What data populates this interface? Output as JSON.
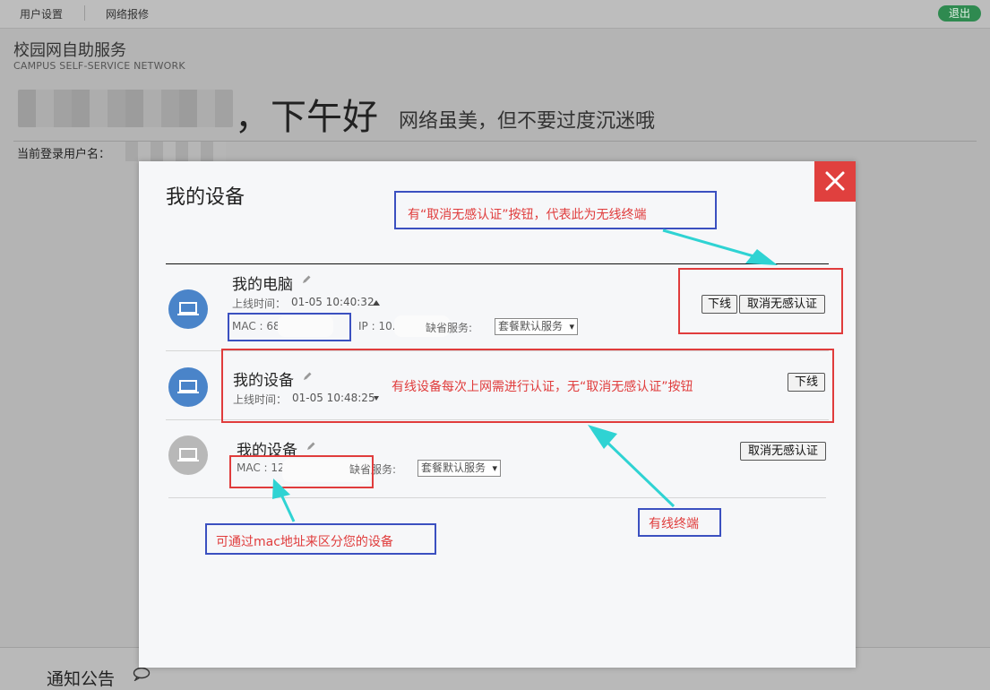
{
  "topnav": {
    "user_settings": "用户设置",
    "network_repair": "网络报修",
    "logout": "退出"
  },
  "brand": {
    "cn": "校园网自助服务",
    "en": "CAMPUS  SELF-SERVICE NETWORK"
  },
  "welcome": {
    "greeting": "，下午好",
    "tagline": "网络虽美，但不要过度沉迷哦",
    "user_label": "当前登录用户名："
  },
  "footer": {
    "notice": "通知公告"
  },
  "modal": {
    "title": "我的设备",
    "devices": [
      {
        "name": "我的电脑",
        "online_time_label": "上线时间：",
        "online_time": "01-05 10:40:32",
        "mac": "MAC : 68",
        "ip": "IP : 10.",
        "service_label": "缺省服务:",
        "service_value": "套餐默认服务",
        "offline_btn": "下线",
        "cancel_btn": "取消无感认证"
      },
      {
        "name": "我的设备",
        "online_time_label": "上线时间：",
        "online_time": "01-05 10:48:25",
        "offline_btn": "下线"
      },
      {
        "name": "我的设备",
        "mac": "MAC : 12",
        "service_label": "缺省服务:",
        "service_value": "套餐默认服务",
        "cancel_btn": "取消无感认证"
      }
    ]
  },
  "annotations": {
    "wireless_note": "有“取消无感认证”按钮，代表此为无线终端",
    "wired_note": "有线设备每次上网需进行认证，无“取消无感认证”按钮",
    "wired_label": "有线终端",
    "mac_note": "可通过mac地址来区分您的设备"
  },
  "colors": {
    "accent_blue": "#4a84c9",
    "close_red": "#e0403e",
    "annotation_red": "#e03c3c",
    "annotation_blue": "#3b50c0",
    "arrow_cyan": "#2fd3d3"
  }
}
